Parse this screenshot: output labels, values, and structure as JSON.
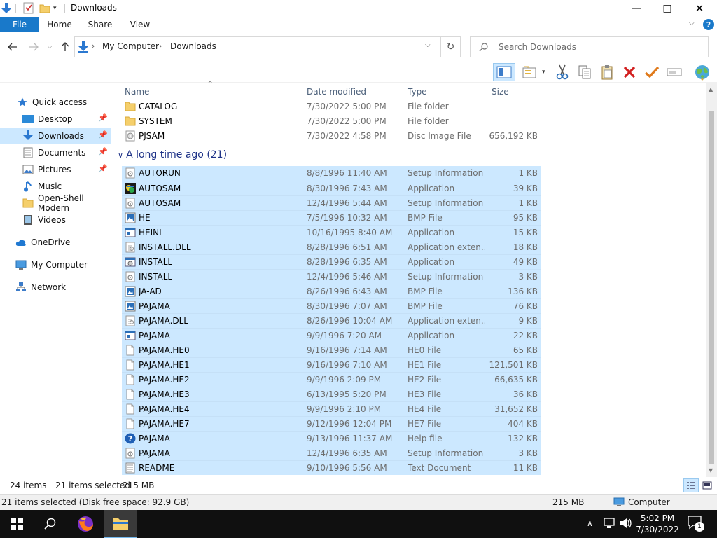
{
  "window": {
    "title": "Downloads",
    "controls": {
      "minimize": "—",
      "maximize": "□",
      "close": "✕"
    }
  },
  "ribbon": {
    "tabs": [
      "File",
      "Home",
      "Share",
      "View"
    ],
    "help": "?"
  },
  "address": {
    "breadcrumb": [
      "My Computer",
      "Downloads"
    ],
    "search_placeholder": "Search Downloads"
  },
  "nav": {
    "items": [
      {
        "label": "Quick access",
        "icon": "star-icon"
      },
      {
        "label": "Desktop",
        "icon": "desktop-icon",
        "pinned": true
      },
      {
        "label": "Downloads",
        "icon": "download-icon",
        "pinned": true,
        "selected": true
      },
      {
        "label": "Documents",
        "icon": "documents-icon",
        "pinned": true
      },
      {
        "label": "Pictures",
        "icon": "pictures-icon",
        "pinned": true
      },
      {
        "label": "Music",
        "icon": "music-icon"
      },
      {
        "label": "Open-Shell Modern",
        "icon": "folder-icon"
      },
      {
        "label": "Videos",
        "icon": "videos-icon"
      },
      {
        "label": "OneDrive",
        "icon": "cloud-icon"
      },
      {
        "label": "My Computer",
        "icon": "computer-icon"
      },
      {
        "label": "Network",
        "icon": "network-icon"
      }
    ]
  },
  "columns": {
    "name": "Name",
    "date": "Date modified",
    "type": "Type",
    "size": "Size"
  },
  "top_files": [
    {
      "name": "CATALOG",
      "date": "7/30/2022 5:00 PM",
      "type": "File folder",
      "size": "",
      "icon": "folder-icon"
    },
    {
      "name": "SYSTEM",
      "date": "7/30/2022 5:00 PM",
      "type": "File folder",
      "size": "",
      "icon": "folder-icon"
    },
    {
      "name": "PJSAM",
      "date": "7/30/2022 4:58 PM",
      "type": "Disc Image File",
      "size": "656,192 KB",
      "icon": "disc-image-icon"
    }
  ],
  "group": {
    "title": "A long time ago (21)"
  },
  "group_files": [
    {
      "name": "AUTORUN",
      "date": "8/8/1996 11:40 AM",
      "type": "Setup Information",
      "size": "1 KB",
      "icon": "setup-info-icon"
    },
    {
      "name": "AUTOSAM",
      "date": "8/30/1996 7:43 AM",
      "type": "Application",
      "size": "39 KB",
      "icon": "autosam-app-icon"
    },
    {
      "name": "AUTOSAM",
      "date": "12/4/1996 5:44 AM",
      "type": "Setup Information",
      "size": "1 KB",
      "icon": "setup-info-icon"
    },
    {
      "name": "HE",
      "date": "7/5/1996 10:32 AM",
      "type": "BMP File",
      "size": "95 KB",
      "icon": "bmp-icon"
    },
    {
      "name": "HEINI",
      "date": "10/16/1995 8:40 AM",
      "type": "Application",
      "size": "15 KB",
      "icon": "application-icon"
    },
    {
      "name": "INSTALL.DLL",
      "date": "8/28/1996 6:51 AM",
      "type": "Application exten...",
      "size": "18 KB",
      "icon": "dll-icon"
    },
    {
      "name": "INSTALL",
      "date": "8/28/1996 6:35 AM",
      "type": "Application",
      "size": "49 KB",
      "icon": "installer-icon"
    },
    {
      "name": "INSTALL",
      "date": "12/4/1996 5:46 AM",
      "type": "Setup Information",
      "size": "3 KB",
      "icon": "setup-info-icon"
    },
    {
      "name": "JA-AD",
      "date": "8/26/1996 6:43 AM",
      "type": "BMP File",
      "size": "136 KB",
      "icon": "bmp-icon"
    },
    {
      "name": "PAJAMA",
      "date": "8/30/1996 7:07 AM",
      "type": "BMP File",
      "size": "76 KB",
      "icon": "bmp-icon"
    },
    {
      "name": "PAJAMA.DLL",
      "date": "8/26/1996 10:04 AM",
      "type": "Application exten...",
      "size": "9 KB",
      "icon": "dll-icon"
    },
    {
      "name": "PAJAMA",
      "date": "9/9/1996 7:20 AM",
      "type": "Application",
      "size": "22 KB",
      "icon": "application-icon"
    },
    {
      "name": "PAJAMA.HE0",
      "date": "9/16/1996 7:14 AM",
      "type": "HE0 File",
      "size": "65 KB",
      "icon": "blank-file-icon"
    },
    {
      "name": "PAJAMA.HE1",
      "date": "9/16/1996 7:10 AM",
      "type": "HE1 File",
      "size": "121,501 KB",
      "icon": "blank-file-icon"
    },
    {
      "name": "PAJAMA.HE2",
      "date": "9/9/1996 2:09 PM",
      "type": "HE2 File",
      "size": "66,635 KB",
      "icon": "blank-file-icon"
    },
    {
      "name": "PAJAMA.HE3",
      "date": "6/13/1995 5:20 PM",
      "type": "HE3 File",
      "size": "36 KB",
      "icon": "blank-file-icon"
    },
    {
      "name": "PAJAMA.HE4",
      "date": "9/9/1996 2:10 PM",
      "type": "HE4 File",
      "size": "31,652 KB",
      "icon": "blank-file-icon"
    },
    {
      "name": "PAJAMA.HE7",
      "date": "9/12/1996 12:04 PM",
      "type": "HE7 File",
      "size": "404 KB",
      "icon": "blank-file-icon"
    },
    {
      "name": "PAJAMA",
      "date": "9/13/1996 11:37 AM",
      "type": "Help file",
      "size": "132 KB",
      "icon": "help-file-icon"
    },
    {
      "name": "PAJAMA",
      "date": "12/4/1996 6:35 AM",
      "type": "Setup Information",
      "size": "3 KB",
      "icon": "setup-info-icon"
    },
    {
      "name": "README",
      "date": "9/10/1996 5:56 AM",
      "type": "Text Document",
      "size": "11 KB",
      "icon": "text-file-icon"
    }
  ],
  "status": {
    "items": "24 items",
    "selected": "21 items selected",
    "size": "215 MB"
  },
  "details": {
    "text": "21 items selected (Disk free space: 92.9 GB)",
    "size": "215 MB",
    "location": "Computer"
  },
  "taskbar": {
    "time": "5:02 PM",
    "date": "7/30/2022",
    "notification_count": "1"
  },
  "colors": {
    "accent": "#1979ca",
    "selection": "#cce8ff",
    "group_header": "#1e3287",
    "taskbar": "#101010"
  }
}
